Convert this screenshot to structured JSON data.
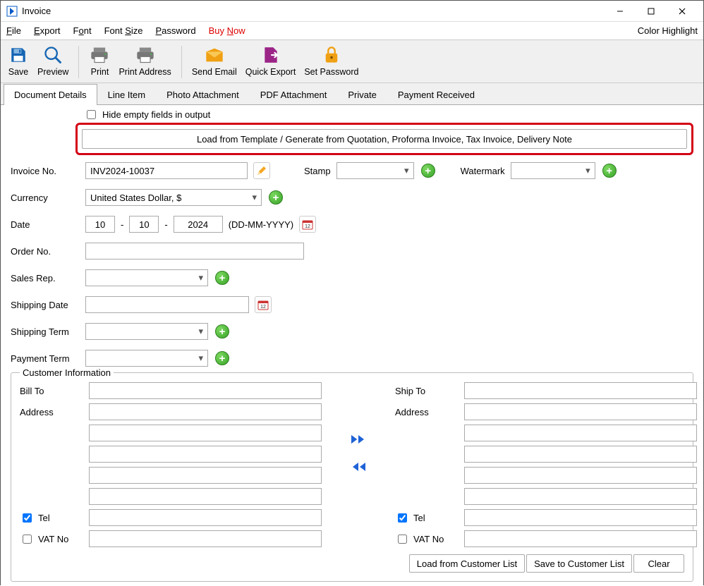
{
  "window": {
    "title": "Invoice"
  },
  "menu": {
    "file": "File",
    "export": "Export",
    "font": "Font",
    "font_size": "Font Size",
    "password": "Password",
    "buy_now": "Buy Now",
    "color_highlight": "Color Highlight"
  },
  "toolbar": {
    "save": "Save",
    "preview": "Preview",
    "print": "Print",
    "print_address": "Print Address",
    "send_email": "Send Email",
    "quick_export": "Quick Export",
    "set_password": "Set Password"
  },
  "tabs": {
    "document_details": "Document Details",
    "line_item": "Line Item",
    "photo_attachment": "Photo Attachment",
    "pdf_attachment": "PDF Attachment",
    "private": "Private",
    "payment_received": "Payment Received"
  },
  "hide_empty_label": "Hide empty fields in output",
  "load_template_button": "Load from Template / Generate from Quotation, Proforma Invoice, Tax Invoice, Delivery Note",
  "labels": {
    "invoice_no": "Invoice No.",
    "stamp": "Stamp",
    "watermark": "Watermark",
    "currency": "Currency",
    "date": "Date",
    "date_format": "(DD-MM-YYYY)",
    "order_no": "Order No.",
    "sales_rep": "Sales Rep.",
    "shipping_date": "Shipping Date",
    "shipping_term": "Shipping Term",
    "payment_term": "Payment Term"
  },
  "values": {
    "invoice_no": "INV2024-10037",
    "currency": "United States Dollar, $",
    "date_dd": "10",
    "date_mm": "10",
    "date_yyyy": "2024",
    "order_no": "",
    "sales_rep": "",
    "shipping_date": "",
    "shipping_term": "",
    "payment_term": "",
    "stamp": "",
    "watermark": ""
  },
  "customer": {
    "fieldset_title": "Customer Information",
    "bill_to": "Bill To",
    "ship_to": "Ship To",
    "address": "Address",
    "tel": "Tel",
    "vat_no": "VAT No",
    "load_from_list": "Load from Customer List",
    "save_to_list": "Save to Customer List",
    "clear": "Clear",
    "bill_tel_checked": true,
    "bill_vat_checked": false,
    "ship_tel_checked": true,
    "ship_vat_checked": false,
    "bill": {
      "name": "",
      "a1": "",
      "a2": "",
      "a3": "",
      "a4": "",
      "a5": "",
      "tel": "",
      "vat": ""
    },
    "ship": {
      "name": "",
      "a1": "",
      "a2": "",
      "a3": "",
      "a4": "",
      "a5": "",
      "tel": "",
      "vat": ""
    }
  }
}
